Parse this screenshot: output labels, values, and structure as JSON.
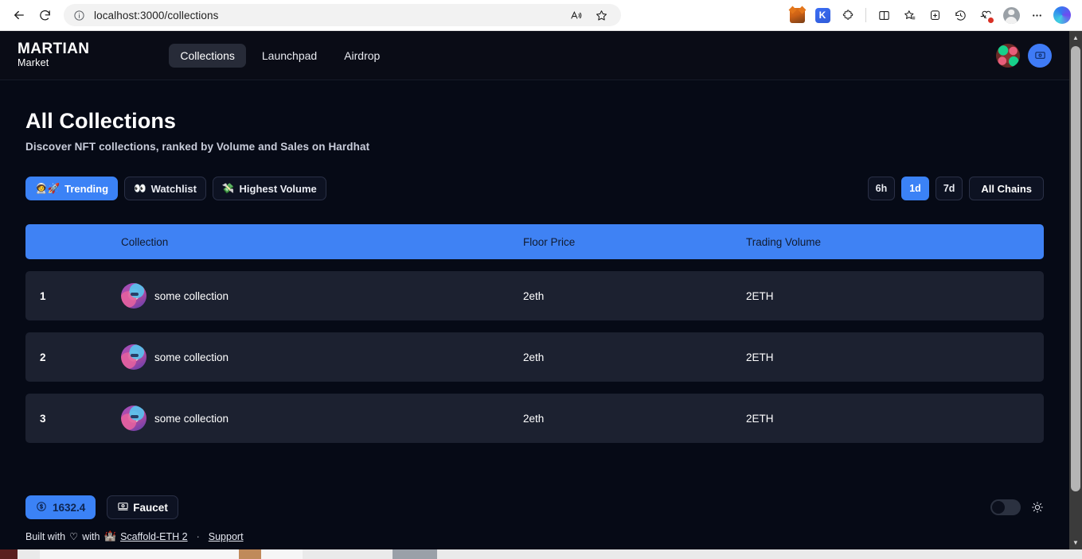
{
  "browser": {
    "url": "localhost:3000/collections",
    "back_label": "Back",
    "refresh_label": "Refresh",
    "site_info_label": "Site information",
    "read_aloud_label": "Read aloud",
    "favorite_label": "Add this page to favorites",
    "extensions": [
      {
        "name": "metamask-extension",
        "label": "MetaMask"
      },
      {
        "name": "keplr-extension",
        "label": "K"
      },
      {
        "name": "extensions-puzzle",
        "label": "Extensions"
      }
    ],
    "split_screen_label": "Split screen",
    "collections_label": "Collections",
    "add_tab_label": "Tab actions",
    "history_label": "History",
    "health_label": "Browser essentials",
    "profile_label": "Profile",
    "settings_label": "Settings and more",
    "copilot_label": "Copilot"
  },
  "nav": {
    "brand_main": "MARTIAN",
    "brand_sub": "Market",
    "links": [
      {
        "label": "Collections",
        "active": true
      },
      {
        "label": "Launchpad",
        "active": false
      },
      {
        "label": "Airdrop",
        "active": false
      }
    ],
    "identicon_label": "account-identicon",
    "wallet_label": "wallet-button"
  },
  "main": {
    "title": "All Collections",
    "subtitle": "Discover NFT collections, ranked by Volume and Sales on Hardhat",
    "filters": [
      {
        "label": "Trending",
        "icon": "🧑‍🚀🚀",
        "active": true
      },
      {
        "label": "Watchlist",
        "icon": "👀",
        "active": false
      },
      {
        "label": "Highest Volume",
        "icon": "💸",
        "active": false
      }
    ],
    "ranges": [
      {
        "label": "6h",
        "active": false
      },
      {
        "label": "1d",
        "active": true
      },
      {
        "label": "7d",
        "active": false
      }
    ],
    "chains_label": "All Chains"
  },
  "table": {
    "columns": [
      "",
      "Collection",
      "Floor Price",
      "Trading Volume"
    ],
    "rows": [
      {
        "rank": "1",
        "name": "some collection",
        "floor": "2eth",
        "volume": "2ETH"
      },
      {
        "rank": "2",
        "name": "some collection",
        "floor": "2eth",
        "volume": "2ETH"
      },
      {
        "rank": "3",
        "name": "some collection",
        "floor": "2eth",
        "volume": "2ETH"
      }
    ]
  },
  "bottom": {
    "balance": "1632.4",
    "balance_icon": "dollar-circle-icon",
    "faucet_label": "Faucet",
    "faucet_icon": "banknote-icon",
    "theme_toggle_label": "theme-toggle",
    "sun_icon": "sun-icon"
  },
  "footer": {
    "built_with_prefix": "Built with",
    "heart": "♡",
    "built_with_mid": "with",
    "castle": "🏰",
    "scaffold": "Scaffold-ETH 2",
    "support": "Support"
  },
  "colors": {
    "accent": "#3b82f6",
    "page_bg": "#060a16",
    "nav_bg": "#0a0c16",
    "row_bg": "#1c2130",
    "header_bg": "#3f82f4"
  }
}
